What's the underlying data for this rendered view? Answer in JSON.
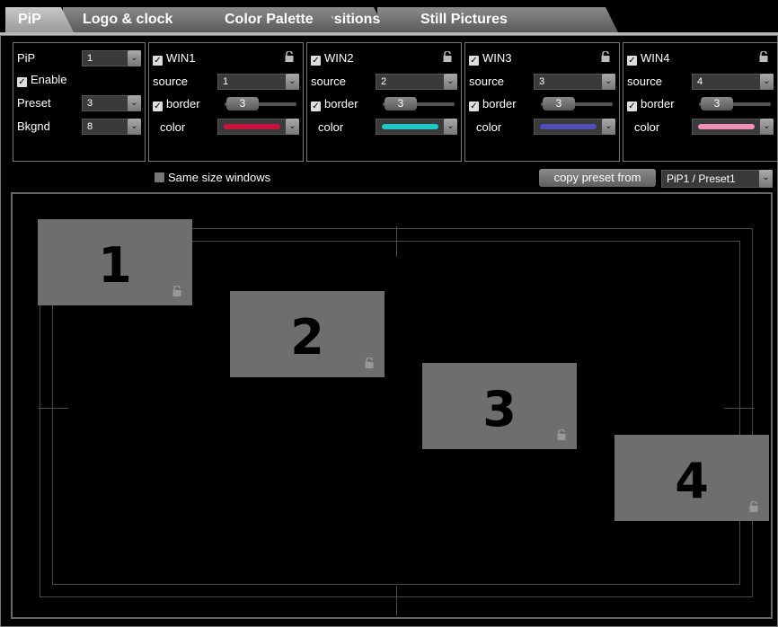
{
  "tabs": [
    "PiP",
    "Logo & clock",
    "Color Palette",
    "Transitions",
    "Still Pictures"
  ],
  "pip_panel": {
    "pip_label": "PiP",
    "pip_value": "1",
    "enable_label": "Enable",
    "preset_label": "Preset",
    "preset_value": "3",
    "bkgnd_label": "Bkgnd",
    "bkgnd_value": "8"
  },
  "windows": [
    {
      "title": "WIN1",
      "source_label": "source",
      "source_value": "1",
      "border_label": "border",
      "border_value": "3",
      "color_label": "color",
      "color": "#c8143c",
      "icon": "unlock-icon"
    },
    {
      "title": "WIN2",
      "source_label": "source",
      "source_value": "2",
      "border_label": "border",
      "border_value": "3",
      "color_label": "color",
      "color": "#1ec8c8",
      "icon": "unlock-icon"
    },
    {
      "title": "WIN3",
      "source_label": "source",
      "source_value": "3",
      "border_label": "border",
      "border_value": "3",
      "color_label": "color",
      "color": "#5050b4",
      "icon": "unlock-icon"
    },
    {
      "title": "WIN4",
      "source_label": "source",
      "source_value": "4",
      "border_label": "border",
      "border_value": "3",
      "color_label": "color",
      "color": "#f090b4",
      "icon": "unlock-icon"
    }
  ],
  "same_size_label": "Same size windows",
  "copy_preset_label": "copy preset from",
  "copy_preset_value": "PiP1 / Preset1",
  "preview_windows": [
    "1",
    "2",
    "3",
    "4"
  ]
}
